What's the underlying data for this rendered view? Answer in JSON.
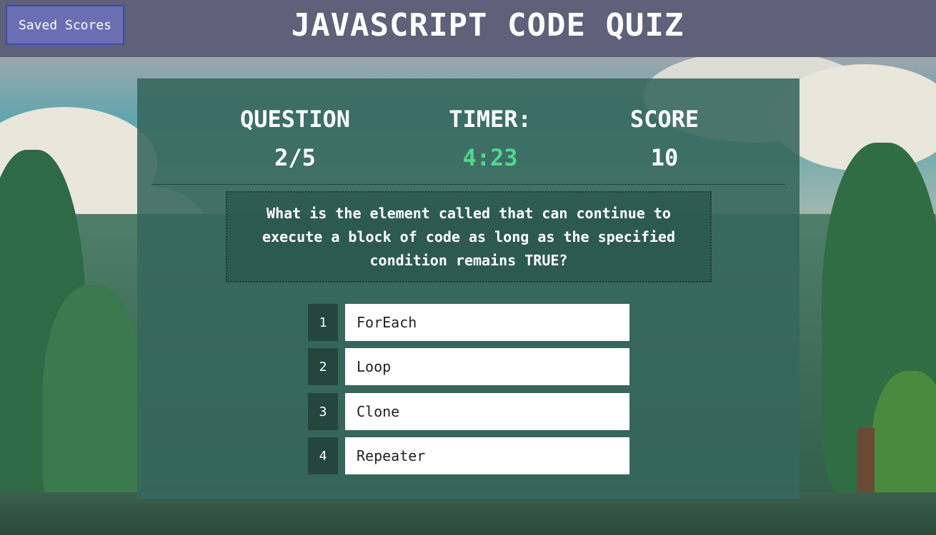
{
  "header": {
    "saved_scores_label": "Saved Scores",
    "title": "JAVASCRIPT CODE QUIZ"
  },
  "stats": {
    "question_label": "QUESTION",
    "question_value": "2/5",
    "timer_label": "TIMER:",
    "timer_value": "4:23",
    "score_label": "SCORE",
    "score_value": "10"
  },
  "question": {
    "text": "What is the element called that can continue to execute a block of code as long as the specified condition remains TRUE?"
  },
  "answers": [
    {
      "number": "1",
      "label": "ForEach"
    },
    {
      "number": "2",
      "label": "Loop"
    },
    {
      "number": "3",
      "label": "Clone"
    },
    {
      "number": "4",
      "label": "Repeater"
    }
  ],
  "colors": {
    "header_bg": "#5e6179",
    "button_bg": "#6a6fb3",
    "timer_accent": "#4fd68f",
    "card_bg": "#36665c"
  }
}
